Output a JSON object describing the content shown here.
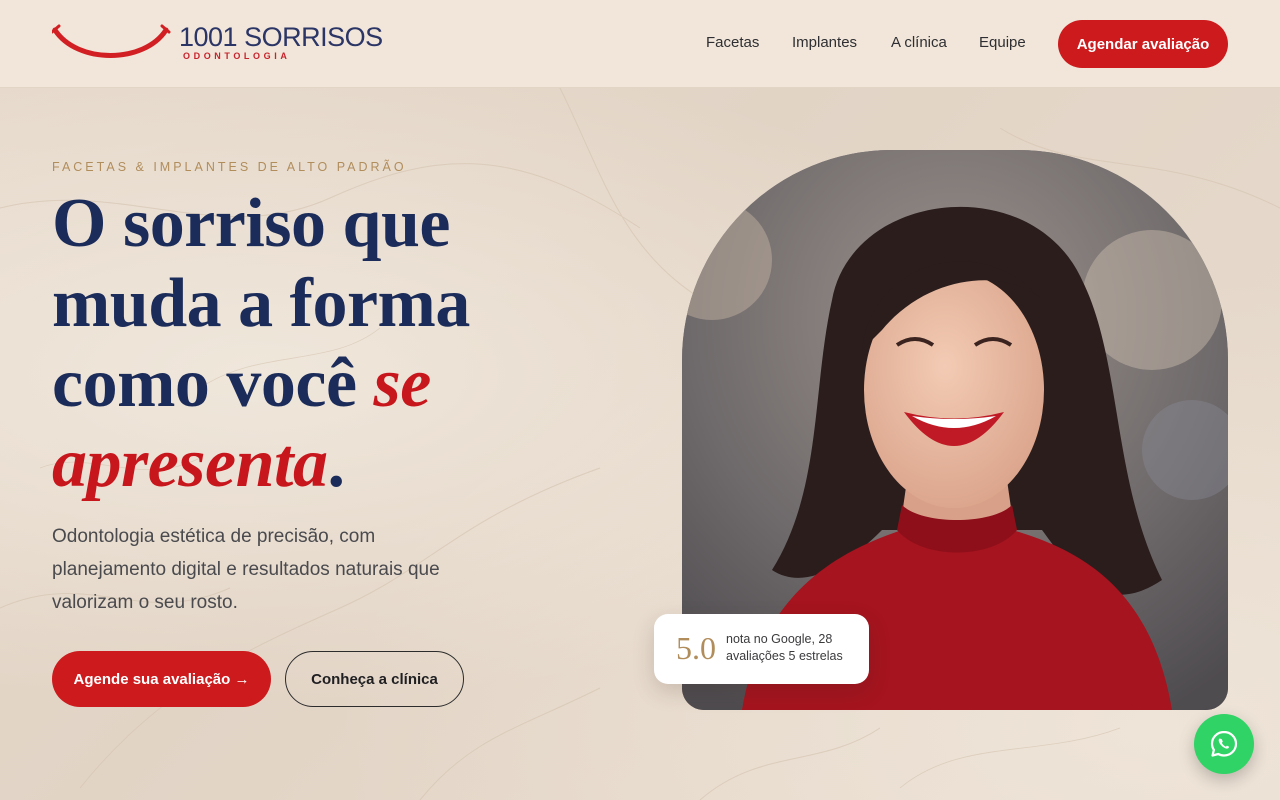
{
  "header": {
    "logo_name": "1001 SORRISOS",
    "logo_sub": "ODONTOLOGIA",
    "nav": [
      {
        "label": "Facetas"
      },
      {
        "label": "Implantes"
      },
      {
        "label": "A clínica"
      },
      {
        "label": "Equipe"
      }
    ],
    "cta_label": "Agendar avaliação"
  },
  "hero": {
    "eyebrow": "FACETAS & IMPLANTES DE ALTO PADRÃO",
    "headline_plain": "O sorriso que muda a forma como você",
    "headline_accent": "se apresenta",
    "headline_end": ".",
    "lead": "Odontologia estética de precisão, com planejamento digital e resultados naturais que valorizam o seu rosto.",
    "primary_button": "Agende sua avaliação →",
    "secondary_button": "Conheça a clínica",
    "photo_icon": "smiling-woman-photo"
  },
  "rating": {
    "score": "5.0",
    "text": "nota no Google, 28 avaliações 5 estrelas"
  },
  "floating": {
    "whatsapp_icon": "whatsapp-icon"
  },
  "colors": {
    "brand_red": "#cc1a1d",
    "navy": "#1b2c5a",
    "gold": "#b18d5c",
    "whatsapp_green": "#2fd366"
  }
}
